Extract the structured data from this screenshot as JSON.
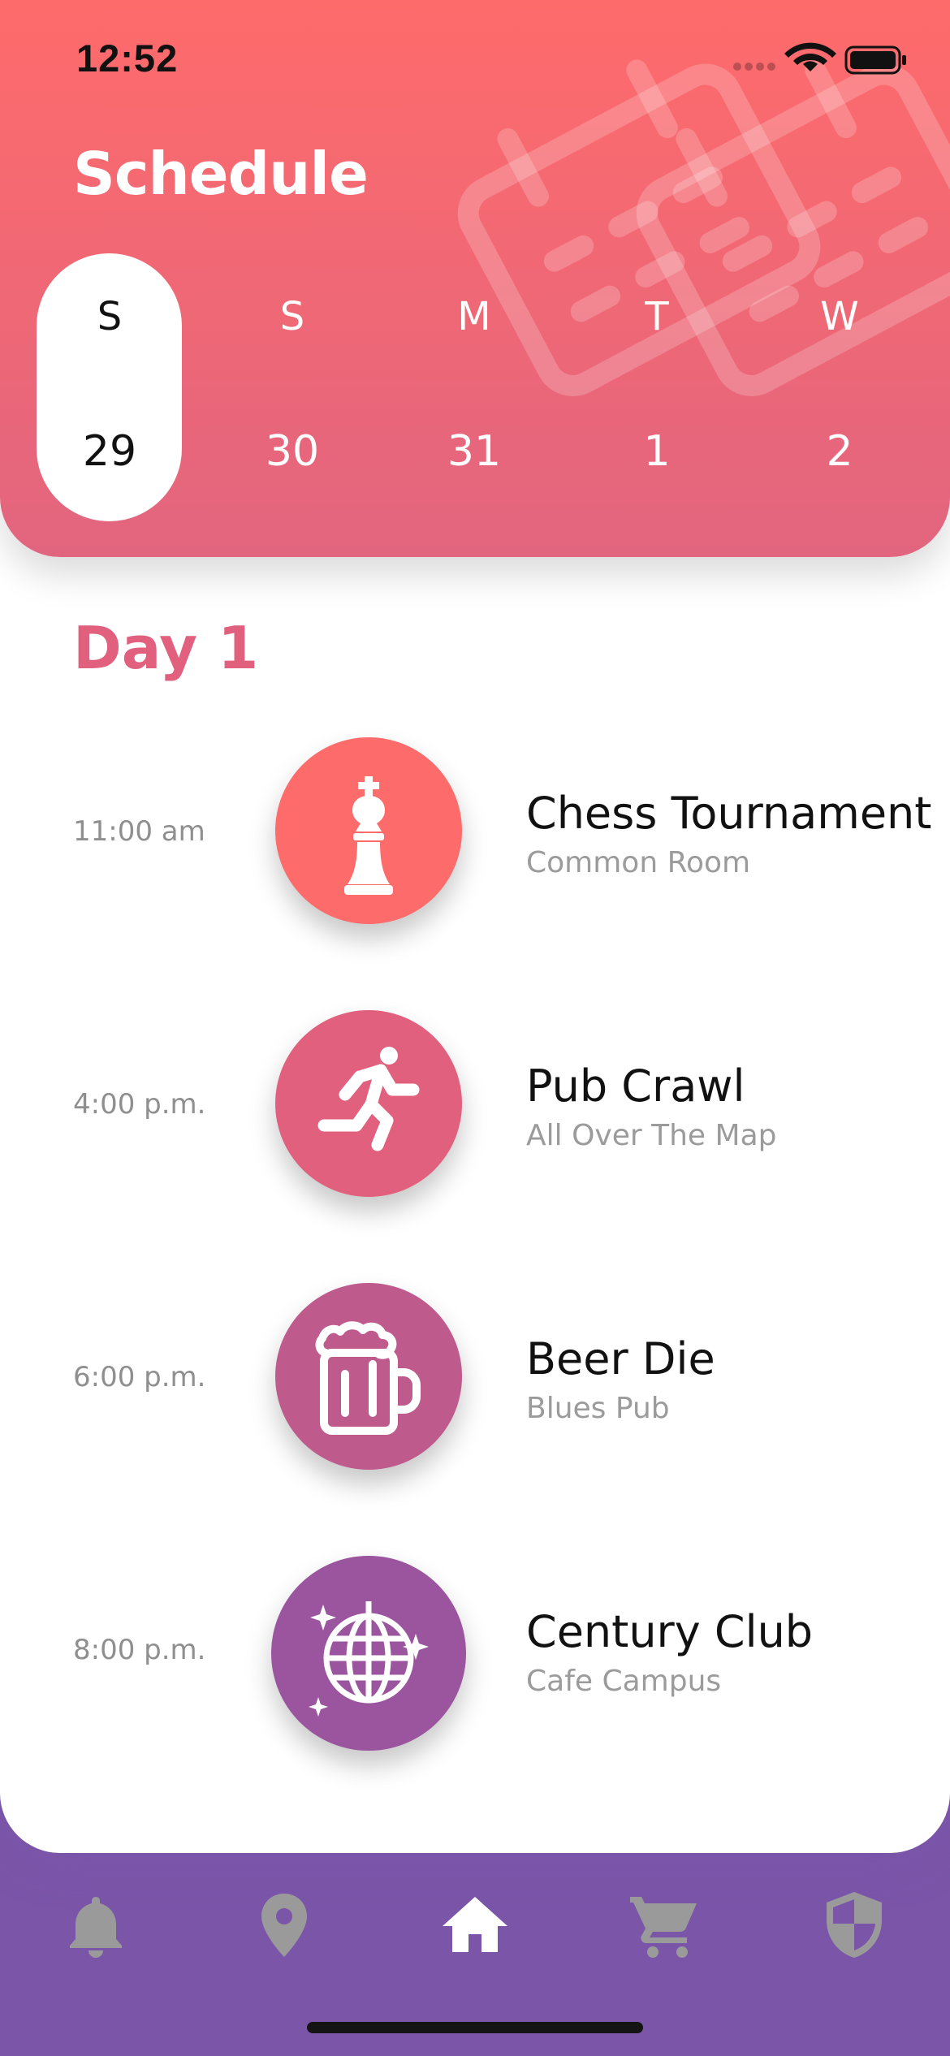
{
  "status_bar": {
    "time": "12:52"
  },
  "header": {
    "title": "Schedule",
    "days": [
      {
        "letter": "S",
        "number": "29",
        "selected": true
      },
      {
        "letter": "S",
        "number": "30",
        "selected": false
      },
      {
        "letter": "M",
        "number": "31",
        "selected": false
      },
      {
        "letter": "T",
        "number": "1",
        "selected": false
      },
      {
        "letter": "W",
        "number": "2",
        "selected": false
      }
    ]
  },
  "section": {
    "title": "Day 1"
  },
  "events": [
    {
      "time": "11:00 am",
      "title": "Chess Tournament",
      "location": "Common Room",
      "icon": "chess-king-icon",
      "color": "#fe6b6b"
    },
    {
      "time": "4:00 p.m.",
      "title": "Pub Crawl",
      "location": "All Over The Map",
      "icon": "running-person-icon",
      "color": "#e0607e"
    },
    {
      "time": "6:00 p.m.",
      "title": "Beer Die",
      "location": "Blues Pub",
      "icon": "beer-mug-icon",
      "color": "#bf5a8c"
    },
    {
      "time": "8:00 p.m.",
      "title": "Century Club",
      "location": "Cafe Campus",
      "icon": "disco-ball-icon",
      "color": "#9b559f"
    }
  ],
  "tab_bar": {
    "items": [
      {
        "icon": "bell-icon",
        "active": false
      },
      {
        "icon": "map-pin-icon",
        "active": false
      },
      {
        "icon": "home-icon",
        "active": true
      },
      {
        "icon": "cart-icon",
        "active": false
      },
      {
        "icon": "shield-icon",
        "active": false
      }
    ],
    "active_color": "#ffffff",
    "inactive_color": "#9a9a9a",
    "background": "#7a55a8"
  }
}
